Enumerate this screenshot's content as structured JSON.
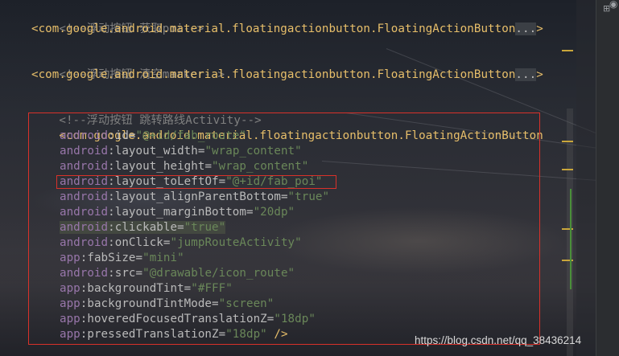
{
  "code": {
    "line1_comment": "<!--浮动按钮 获取poi-->",
    "line2_tag": "<com.google.android.material.floatingactionbutton.FloatingActionButton",
    "line2_fold": "...",
    "line2_close": ">",
    "line3_comment": "<!--浮动按钮 清空marker-->",
    "line4_tag": "<com.google.android.material.floatingactionbutton.FloatingActionButton",
    "line4_fold": "...",
    "line4_close": ">",
    "line5_comment": "<!--浮动按钮 跳转路线Activity-->",
    "line6_tag": "<com.google.android.material.floatingactionbutton.FloatingActionButton",
    "attrs": [
      {
        "ns": "android",
        "name": "id",
        "value": "\"@+id/fab_route\""
      },
      {
        "ns": "android",
        "name": "layout_width",
        "value": "\"wrap_content\""
      },
      {
        "ns": "android",
        "name": "layout_height",
        "value": "\"wrap_content\""
      },
      {
        "ns": "android",
        "name": "layout_toLeftOf",
        "value": "\"@+id/fab_poi\""
      },
      {
        "ns": "android",
        "name": "layout_alignParentBottom",
        "value": "\"true\""
      },
      {
        "ns": "android",
        "name": "layout_marginBottom",
        "value": "\"20dp\""
      },
      {
        "ns": "android",
        "name": "clickable",
        "value": "\"true\""
      },
      {
        "ns": "android",
        "name": "onClick",
        "value": "\"jumpRouteActivity\""
      },
      {
        "ns": "app",
        "name": "fabSize",
        "value": "\"mini\""
      },
      {
        "ns": "android",
        "name": "src",
        "value": "\"@drawable/icon_route\""
      },
      {
        "ns": "app",
        "name": "backgroundTint",
        "value": "\"#FFF\""
      },
      {
        "ns": "app",
        "name": "backgroundTintMode",
        "value": "\"screen\""
      },
      {
        "ns": "app",
        "name": "hoveredFocusedTranslationZ",
        "value": "\"18dp\""
      },
      {
        "ns": "app",
        "name": "pressedTranslationZ",
        "value": "\"18dp\"",
        "tail": " />"
      }
    ]
  },
  "watermark": "https://blog.csdn.net/qq_38436214",
  "colors": {
    "comment": "#808080",
    "tag": "#e8bf6a",
    "namespace": "#9876aa",
    "attribute": "#bababa",
    "value": "#6a8759",
    "highlight_border": "#d9312a"
  },
  "rail_icons": [
    "panel-icon",
    "eye-icon"
  ]
}
